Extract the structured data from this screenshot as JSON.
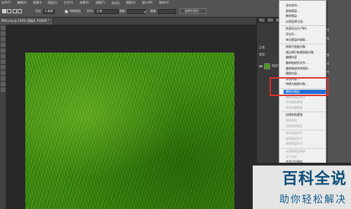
{
  "menubar": {
    "items": [
      "文件(F)",
      "编辑(E)",
      "图像(I)",
      "图层(L)",
      "文字(Y)",
      "选择(S)",
      "滤镜(T)",
      "3D(D)",
      "视图(V)",
      "窗口(W)",
      "帮助(H)"
    ]
  },
  "options": {
    "feather_label": "羽化:",
    "feather_value": "0 像素",
    "antialias_label": "消除锯齿",
    "style_label": "样式:",
    "style_value": "正常",
    "width_label": "宽度:",
    "height_label": "高度:",
    "refine_button": "选择并遮住..."
  },
  "document": {
    "tab_label": "草坪.png @ 100% (图层0, RGB/8) *"
  },
  "panels": {
    "tabs": [
      "图层",
      "通道",
      "路径"
    ],
    "layer_rows": [
      "正常",
      "锁定:",
      "图层0"
    ]
  },
  "right_column": {
    "items": [
      "颜色",
      "色板",
      "库",
      "调整",
      "样式",
      "属性"
    ]
  },
  "context_menu": {
    "items": [
      {
        "label": "混合选项...",
        "state": "normal"
      },
      {
        "label": "复制图层...",
        "state": "normal"
      },
      {
        "label": "删除图层",
        "state": "normal"
      },
      {
        "label": "从图层建立组...",
        "state": "normal"
      },
      {
        "label": "快速导出为 PNG",
        "state": "normal"
      },
      {
        "label": "导出为...",
        "state": "normal"
      },
      {
        "label": "来自图层的画板...",
        "state": "normal"
      },
      {
        "label": "转换为智能对象",
        "state": "normal"
      },
      {
        "label": "通过拷贝新建智能对象",
        "state": "normal"
      },
      {
        "label": "编辑内容",
        "state": "normal"
      },
      {
        "label": "重新链接到文件...",
        "state": "normal"
      },
      {
        "label": "重新链接到库图形...",
        "state": "normal"
      },
      {
        "label": "替换内容...",
        "state": "normal"
      },
      {
        "label": "导出内容...",
        "state": "normal"
      },
      {
        "label": "转换为链接对象...",
        "state": "normal"
      },
      {
        "label": "栅格化图层",
        "state": "selected"
      },
      {
        "label": "栅格化图层样式",
        "state": "disabled"
      },
      {
        "label": "停用图层蒙版",
        "state": "disabled"
      },
      {
        "label": "停用矢量蒙版",
        "state": "disabled"
      },
      {
        "label": "创建剪贴蒙版",
        "state": "normal"
      },
      {
        "label": "链接图层",
        "state": "disabled"
      },
      {
        "label": "选择链接图层",
        "state": "disabled"
      },
      {
        "label": "拷贝图层样式",
        "state": "disabled"
      },
      {
        "label": "粘贴图层样式",
        "state": "disabled"
      },
      {
        "label": "清除图层样式",
        "state": "disabled"
      },
      {
        "label": "从隔离图层释放",
        "state": "disabled"
      },
      {
        "label": "向下合并",
        "state": "disabled"
      },
      {
        "label": "合并可见图层",
        "state": "normal"
      },
      {
        "label": "拼合图像",
        "state": "normal"
      },
      {
        "label": "无颜色",
        "state": "normal"
      },
      {
        "label": "红色",
        "state": "normal"
      },
      {
        "label": "从所选图层新建 3D 模型",
        "state": "normal"
      }
    ]
  },
  "watermark": {
    "title": "百科全说",
    "subtitle": "助你轻松解决"
  }
}
